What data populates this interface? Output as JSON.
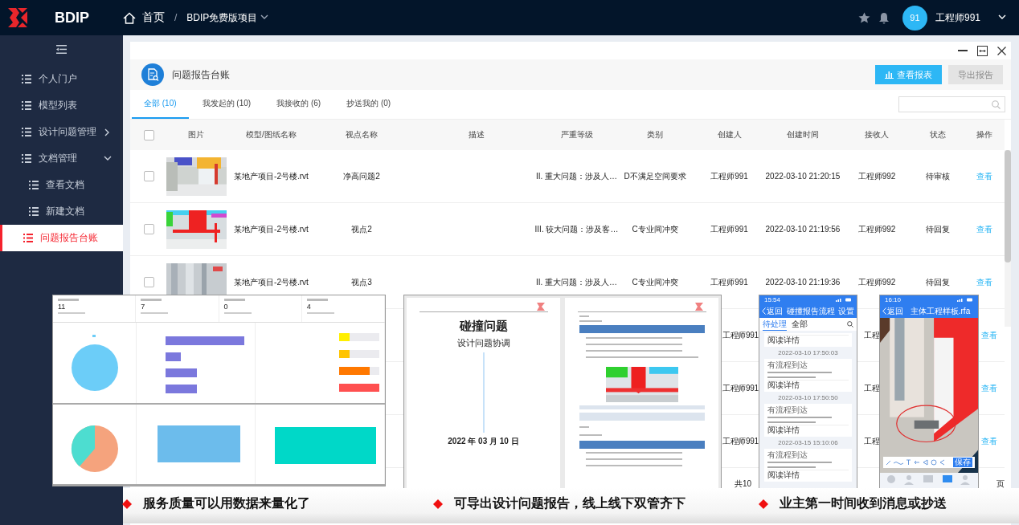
{
  "topbar": {
    "logo": "BDIP",
    "breadcrumb": {
      "home": "首页",
      "separator": "/",
      "project": "BDIP免费版项目"
    },
    "avatar": "91",
    "user": "工程师991"
  },
  "sidebar": {
    "items": [
      {
        "label": "个人门户",
        "selected": false
      },
      {
        "label": "模型列表",
        "selected": false
      },
      {
        "label": "设计问题管理",
        "selected": false,
        "expanded": false
      },
      {
        "label": "文档管理",
        "selected": false,
        "expanded": true,
        "children": [
          {
            "label": "查看文档",
            "selected": false
          },
          {
            "label": "新建文档",
            "selected": false
          }
        ]
      },
      {
        "label": "问题报告台账",
        "selected": true
      }
    ]
  },
  "panel": {
    "title": "问题报告台账",
    "buttons": [
      {
        "label": "查看报表",
        "disabled": false
      },
      {
        "label": "导出报告",
        "disabled": true
      }
    ],
    "tabs": [
      {
        "label": "全部 (10)",
        "selected": true
      },
      {
        "label": "我发起的 (10)",
        "selected": false
      },
      {
        "label": "我接收的 (6)",
        "selected": false
      },
      {
        "label": "抄送我的 (0)",
        "selected": false
      }
    ],
    "table": {
      "header_checked": false,
      "columns": [
        "图片",
        "模型/图纸名称",
        "视点名称",
        "描述",
        "严重等级",
        "类别",
        "创建人",
        "创建时间",
        "接收人",
        "状态",
        "操作"
      ],
      "rows": [
        {
          "kind": "full",
          "checked": false,
          "model": "某地产项目-2号楼.rvt",
          "viewpoint": "净高问题2",
          "severity": "II. 重大问题：涉及人…",
          "category": "D不满足空间要求",
          "creator": "工程师991",
          "created": "2022-03-10 21:20:15",
          "receiver": "工程师992",
          "status": "待审核",
          "action": "查看"
        },
        {
          "kind": "full",
          "checked": false,
          "model": "某地产项目-2号楼.rvt",
          "viewpoint": "视点2",
          "severity": "III. 较大问题：涉及客…",
          "category": "C专业间冲突",
          "creator": "工程师991",
          "created": "2022-03-10 21:19:56",
          "receiver": "工程师992",
          "status": "待回复",
          "action": "查看"
        },
        {
          "kind": "full",
          "checked": false,
          "model": "某地产项目-2号楼.rvt",
          "viewpoint": "视点3",
          "severity": "II. 重大问题：涉及人…",
          "category": "C专业间冲突",
          "creator": "工程师991",
          "created": "2022-03-10 21:19:36",
          "receiver": "工程师992",
          "status": "待回复",
          "action": "查看"
        },
        {
          "kind": "partial",
          "creator": "工程师991",
          "receiver": "工程",
          "action": "查看"
        },
        {
          "kind": "partial",
          "creator": "工程师991",
          "receiver": "工程",
          "action": "查看"
        },
        {
          "kind": "partial",
          "creator": "工程师991",
          "receiver": "工程",
          "action": "查看"
        }
      ]
    },
    "pagination": {
      "total": "共10",
      "unit": "页"
    }
  },
  "dashboard": {
    "stats": [
      {
        "value": "11"
      },
      {
        "value": "7"
      },
      {
        "value": "0"
      },
      {
        "value": "4"
      }
    ]
  },
  "document": {
    "pages": [
      {
        "kind": "cover",
        "title": "碰撞问题",
        "subtitle": "设计问题协调",
        "date": "2022 年 03 月 10 日"
      },
      {
        "kind": "report"
      }
    ]
  },
  "phone_list": {
    "time": "15:54",
    "back": "返回",
    "title": "碰撞报告流程",
    "action": "设置",
    "tabs": [
      {
        "label": "待处理",
        "selected": true
      },
      {
        "label": "全部",
        "selected": false
      }
    ],
    "messages": [
      {
        "kind": "tail",
        "link": "阅读详情"
      },
      {
        "kind": "card",
        "time": "2022-03-10 17:50:03",
        "heading": "有流程到达",
        "link": "阅读详情"
      },
      {
        "kind": "card",
        "time": "2022-03-10 17:50:50",
        "heading": "有流程到达",
        "link": "阅读详情"
      },
      {
        "kind": "card",
        "time": "2022-03-15 15:10:06",
        "heading": "有流程到达",
        "link": "阅读详情"
      }
    ]
  },
  "phone_model": {
    "time": "16:10",
    "back": "返回",
    "title": "主体工程样板.rfa",
    "save": "保存"
  },
  "captions": [
    {
      "text": "服务质量可以用数据来量化了"
    },
    {
      "text": "可导出设计问题报告，线上线下双管齐下"
    },
    {
      "text": "业主第一时间收到消息或抄送"
    }
  ]
}
